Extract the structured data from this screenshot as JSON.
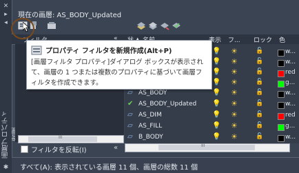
{
  "panel": {
    "current_layer_label": "現在の画層: AS_BODY_Updated",
    "vertical_title": "画層プロパティ管理",
    "titlebar_buttons": [
      "✕",
      "▸",
      "◂",
      "✱"
    ]
  },
  "columns": {
    "filter": "フィルタ",
    "collapse": "«",
    "status": "状",
    "name": "名前",
    "name_sort": "▲",
    "on": "表示",
    "freeze": "フ...",
    "lock": "ロック",
    "color": "色"
  },
  "tooltip": {
    "title": "プロパティ フィルタを新規作成(Alt+P)",
    "body": "[画層フィルタ プロパティ]ダイアログ ボックスが表示されて、画層の 1 つまたは複数のプロパティに基づいて画層フィルタを作成できます。"
  },
  "layers": [
    {
      "status": "",
      "name": "",
      "on": "💡",
      "freeze": "☀",
      "lock": "🔓",
      "color_hex": "#000000",
      "color_name": "w..."
    },
    {
      "status": "",
      "name": "",
      "on": "💡",
      "freeze": "☀",
      "lock": "🔓",
      "color_hex": "#000000",
      "color_name": "w..."
    },
    {
      "status": "",
      "name": "",
      "on": "💡",
      "freeze": "☀",
      "lock": "🔓",
      "color_hex": "#ff0000",
      "color_name": "red"
    },
    {
      "status": "",
      "name": "",
      "on": "💡",
      "freeze": "☀",
      "lock": "🔓",
      "color_hex": "#00ff00",
      "color_name": "g..."
    },
    {
      "status": "▱",
      "name": "AS_BODY",
      "on": "💡",
      "freeze": "☀",
      "lock": "🔓",
      "color_hex": "#000000",
      "color_name": "w..."
    },
    {
      "status": "✔",
      "name": "AS_BODY_Updated",
      "on": "💡",
      "freeze": "☀",
      "lock": "🔓",
      "color_hex": "#000000",
      "color_name": "w..."
    },
    {
      "status": "▱",
      "name": "AS_DIM",
      "on": "💡",
      "freeze": "☀",
      "lock": "🔓",
      "color_hex": "#ff0000",
      "color_name": "red"
    },
    {
      "status": "▱",
      "name": "AS_FILL",
      "on": "💡",
      "freeze": "☀",
      "lock": "🔓",
      "color_hex": "#00ff00",
      "color_name": "g..."
    },
    {
      "status": "▱",
      "name": "B_BODY",
      "on": "💡",
      "freeze": "☀",
      "lock": "🔓",
      "color_hex": "#000000",
      "color_name": "w..."
    }
  ],
  "filter_pane": {
    "invert_label": "フィルタを反転(I)",
    "collapse": "«",
    "scroll_glyph": "III"
  },
  "layer_scroll_glyph": "III",
  "status_bar": "すべて(A): 表示されている画層 11 個、画層の総数 11 個"
}
